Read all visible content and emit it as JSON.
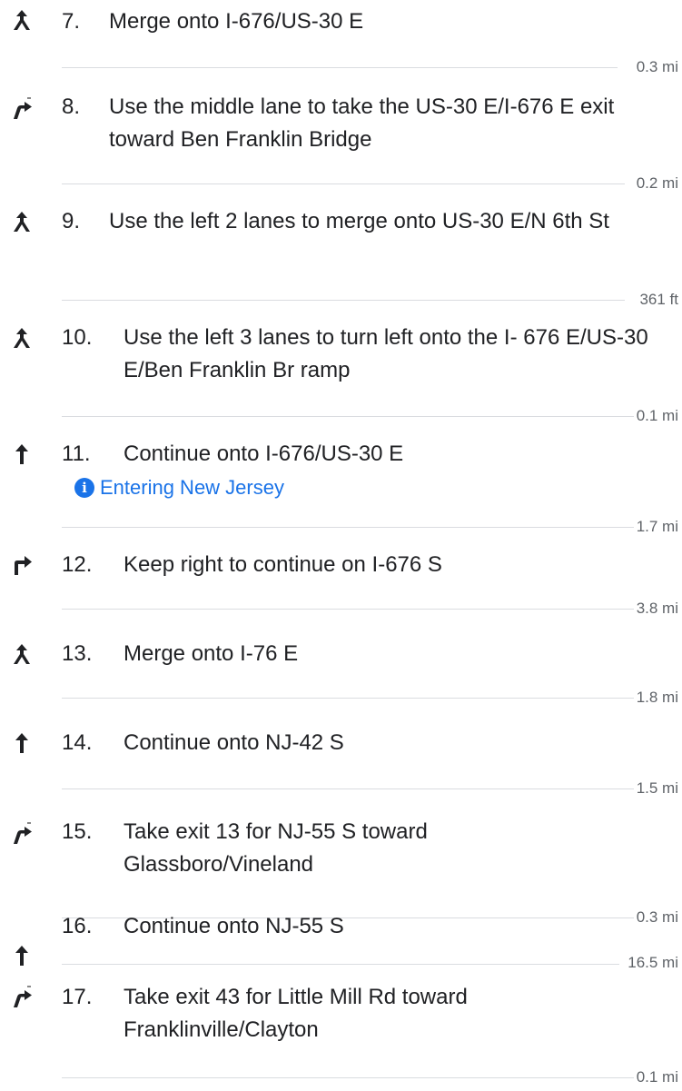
{
  "directions": [
    {
      "number": "7.",
      "text": "Merge onto I-676/US-30 E",
      "icon": "merge-icon",
      "distance": "0.3 mi"
    },
    {
      "number": "8.",
      "text": "Use the middle lane to take the US-30 E/I-676 E exit toward Ben Franklin Bridge",
      "icon": "ramp-right-icon",
      "distance": "0.2 mi"
    },
    {
      "number": "9.",
      "text": "Use the left 2 lanes to merge onto US-30 E/N 6th St",
      "icon": "merge-icon",
      "distance": "361 ft"
    },
    {
      "number": "10.",
      "text": "Use the left 3 lanes to turn left onto the I- 676 E/US-30 E/Ben Franklin Br ramp",
      "icon": "merge-icon",
      "distance": "0.1 mi"
    },
    {
      "number": "11.",
      "text": "Continue onto I-676/US-30 E",
      "icon": "straight-icon",
      "note": "Entering New Jersey",
      "distance": "1.7 mi"
    },
    {
      "number": "12.",
      "text": "Keep right to continue on I-676 S",
      "icon": "keep-right-icon",
      "distance": "3.8 mi"
    },
    {
      "number": "13.",
      "text": "Merge onto I-76 E",
      "icon": "merge-icon",
      "distance": "1.8 mi"
    },
    {
      "number": "14.",
      "text": "Continue onto NJ-42 S",
      "icon": "straight-icon",
      "distance": "1.5 mi"
    },
    {
      "number": "15.",
      "text": "Take exit 13 for NJ-55 S toward Glassboro/Vineland",
      "icon": "ramp-right-icon",
      "distance": "0.3 mi"
    },
    {
      "number": "16.",
      "text": "Continue onto NJ-55 S",
      "icon": "straight-icon",
      "distance": "16.5 mi"
    },
    {
      "number": "17.",
      "text": "Take exit 43 for Little Mill Rd toward Franklinville/Clayton",
      "icon": "ramp-right-icon",
      "distance": "0.1 mi"
    }
  ]
}
